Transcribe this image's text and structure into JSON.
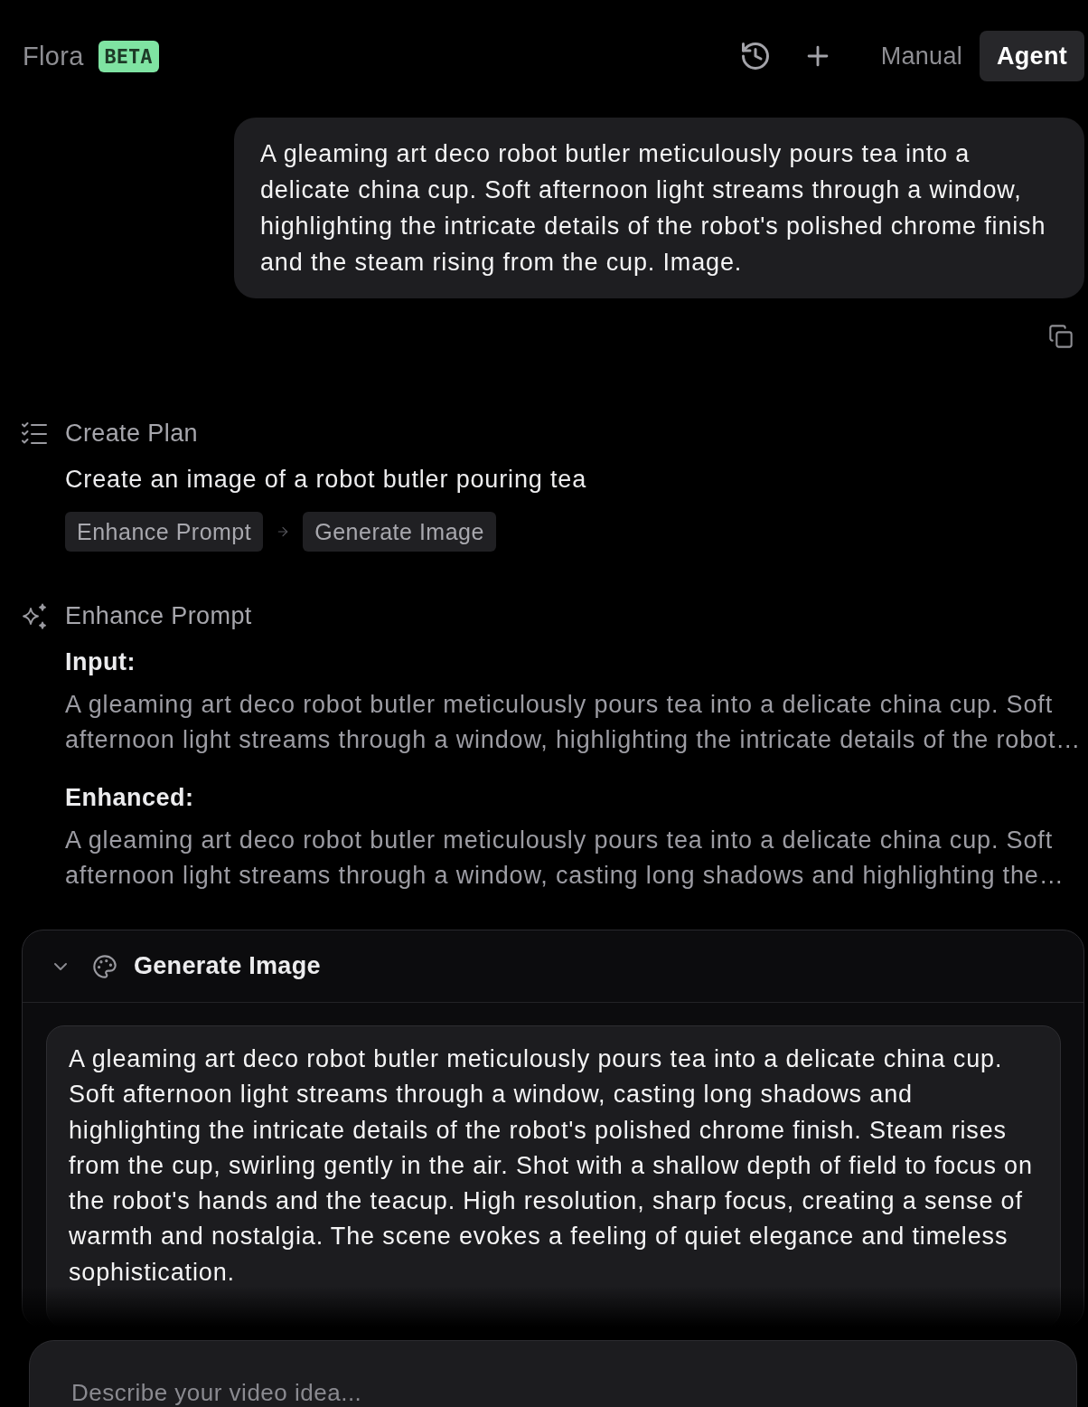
{
  "header": {
    "brand": "Flora",
    "badge": "BETA",
    "modes": [
      {
        "label": "Manual",
        "selected": false
      },
      {
        "label": "Agent",
        "selected": true
      }
    ]
  },
  "user_message": {
    "text": "A gleaming art deco robot butler meticulously pours tea into a delicate china cup. Soft afternoon light streams through a window, highlighting the intricate details of the robot's polished chrome finish and the steam rising from the cup. Image."
  },
  "steps": [
    {
      "kind": "plan",
      "title": "Create Plan",
      "description": "Create an image of a robot butler pouring tea",
      "chips": [
        "Enhance Prompt",
        "Generate Image"
      ]
    },
    {
      "kind": "enhance",
      "title": "Enhance Prompt",
      "fields": [
        {
          "label": "Input:",
          "text": "A gleaming art deco robot butler meticulously pours tea into a delicate china cup. Soft afternoon light streams through a window, highlighting the intricate details of the robot…"
        },
        {
          "label": "Enhanced:",
          "text": "A gleaming art deco robot butler meticulously pours tea into a delicate china cup. Soft afternoon light streams through a window, casting long shadows and highlighting the…"
        }
      ]
    },
    {
      "kind": "generate",
      "title": "Generate Image",
      "expanded": true,
      "prompt": "A gleaming art deco robot butler meticulously pours tea into a delicate china cup. Soft afternoon light streams through a window, casting long shadows and highlighting the intricate details of the robot's polished chrome finish. Steam rises from the cup, swirling gently in the air. Shot with a shallow depth of field to focus on the robot's hands and the teacup. High resolution, sharp focus, creating a sense of warmth and nostalgia. The scene evokes a feeling of quiet elegance and timeless sophistication."
    }
  ],
  "composer": {
    "placeholder": "Describe your video idea..."
  }
}
